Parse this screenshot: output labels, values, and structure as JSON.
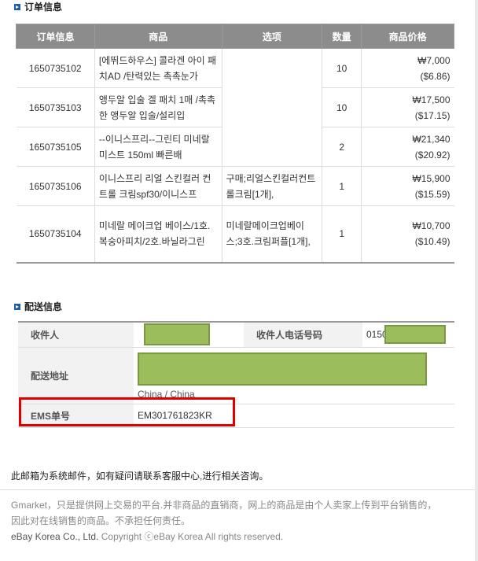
{
  "order_section": {
    "title": "订单信息",
    "headers": [
      "订单信息",
      "商品",
      "选项",
      "数量",
      "商品价格"
    ],
    "rows": [
      {
        "order_id": "1650735102",
        "product": "[에뛰드하우스] 콜라겐 아이 패치AD /탄력있는 촉촉눈가",
        "option": "",
        "qty": "10",
        "price_krw": "₩7,000",
        "price_usd": "($6.86)"
      },
      {
        "order_id": "1650735103",
        "product": "앵두알 입술 겔 패치 1매 /촉촉한 앵두알 입술/설리입",
        "option": "",
        "qty": "10",
        "price_krw": "₩17,500",
        "price_usd": "($17.15)"
      },
      {
        "order_id": "1650735105",
        "product": "--이니스프리--그린티 미네랄 미스트 150ml 빠른배",
        "option": "",
        "qty": "2",
        "price_krw": "₩21,340",
        "price_usd": "($20.92)"
      },
      {
        "order_id": "1650735106",
        "product": "이니스프리 리얼 스킨컬러 컨트롤 크림spf30/이니스프",
        "option": "구매;리얼스킨컬러컨트롤크림[1개],",
        "qty": "1",
        "price_krw": "₩15,900",
        "price_usd": "($15.59)"
      },
      {
        "order_id": "1650735104",
        "product": "미네랄 메이크업 베이스/1호.복숭아피치/2호.바닐라그린",
        "option": "미네랄메이크업베이스;3호.크림퍼플[1개],",
        "qty": "1",
        "price_krw": "₩10,700",
        "price_usd": "($10.49)"
      }
    ]
  },
  "shipping_section": {
    "title": "配送信息",
    "recipient_label": "收件人",
    "phone_label": "收件人电话号码",
    "phone_prefix": "0150",
    "address_label": "配送地址",
    "country": "China / China",
    "ems_label": "EMS单号",
    "ems_number": "EM301761823KR"
  },
  "notice": "此邮箱为系统邮件，如有疑问请联系客服中心,进行相关咨询。",
  "footer": {
    "line1": "Gmarket，只是提供网上交易的平台.并非商品的直销商，网上的商品是由个人卖家上传到平台销售的，",
    "line2": "因此对在线销售的商品。不承担任何责任。",
    "company": "eBay Korea Co., Ltd.",
    "copyright": " Copyright ⓒeBay Korea All rights reserved."
  },
  "colors": {
    "header_bg": "#8c8c8c",
    "mask_green": "#9bbd5b",
    "highlight_red": "#e00000",
    "bullet_blue": "#1f5f9f"
  }
}
